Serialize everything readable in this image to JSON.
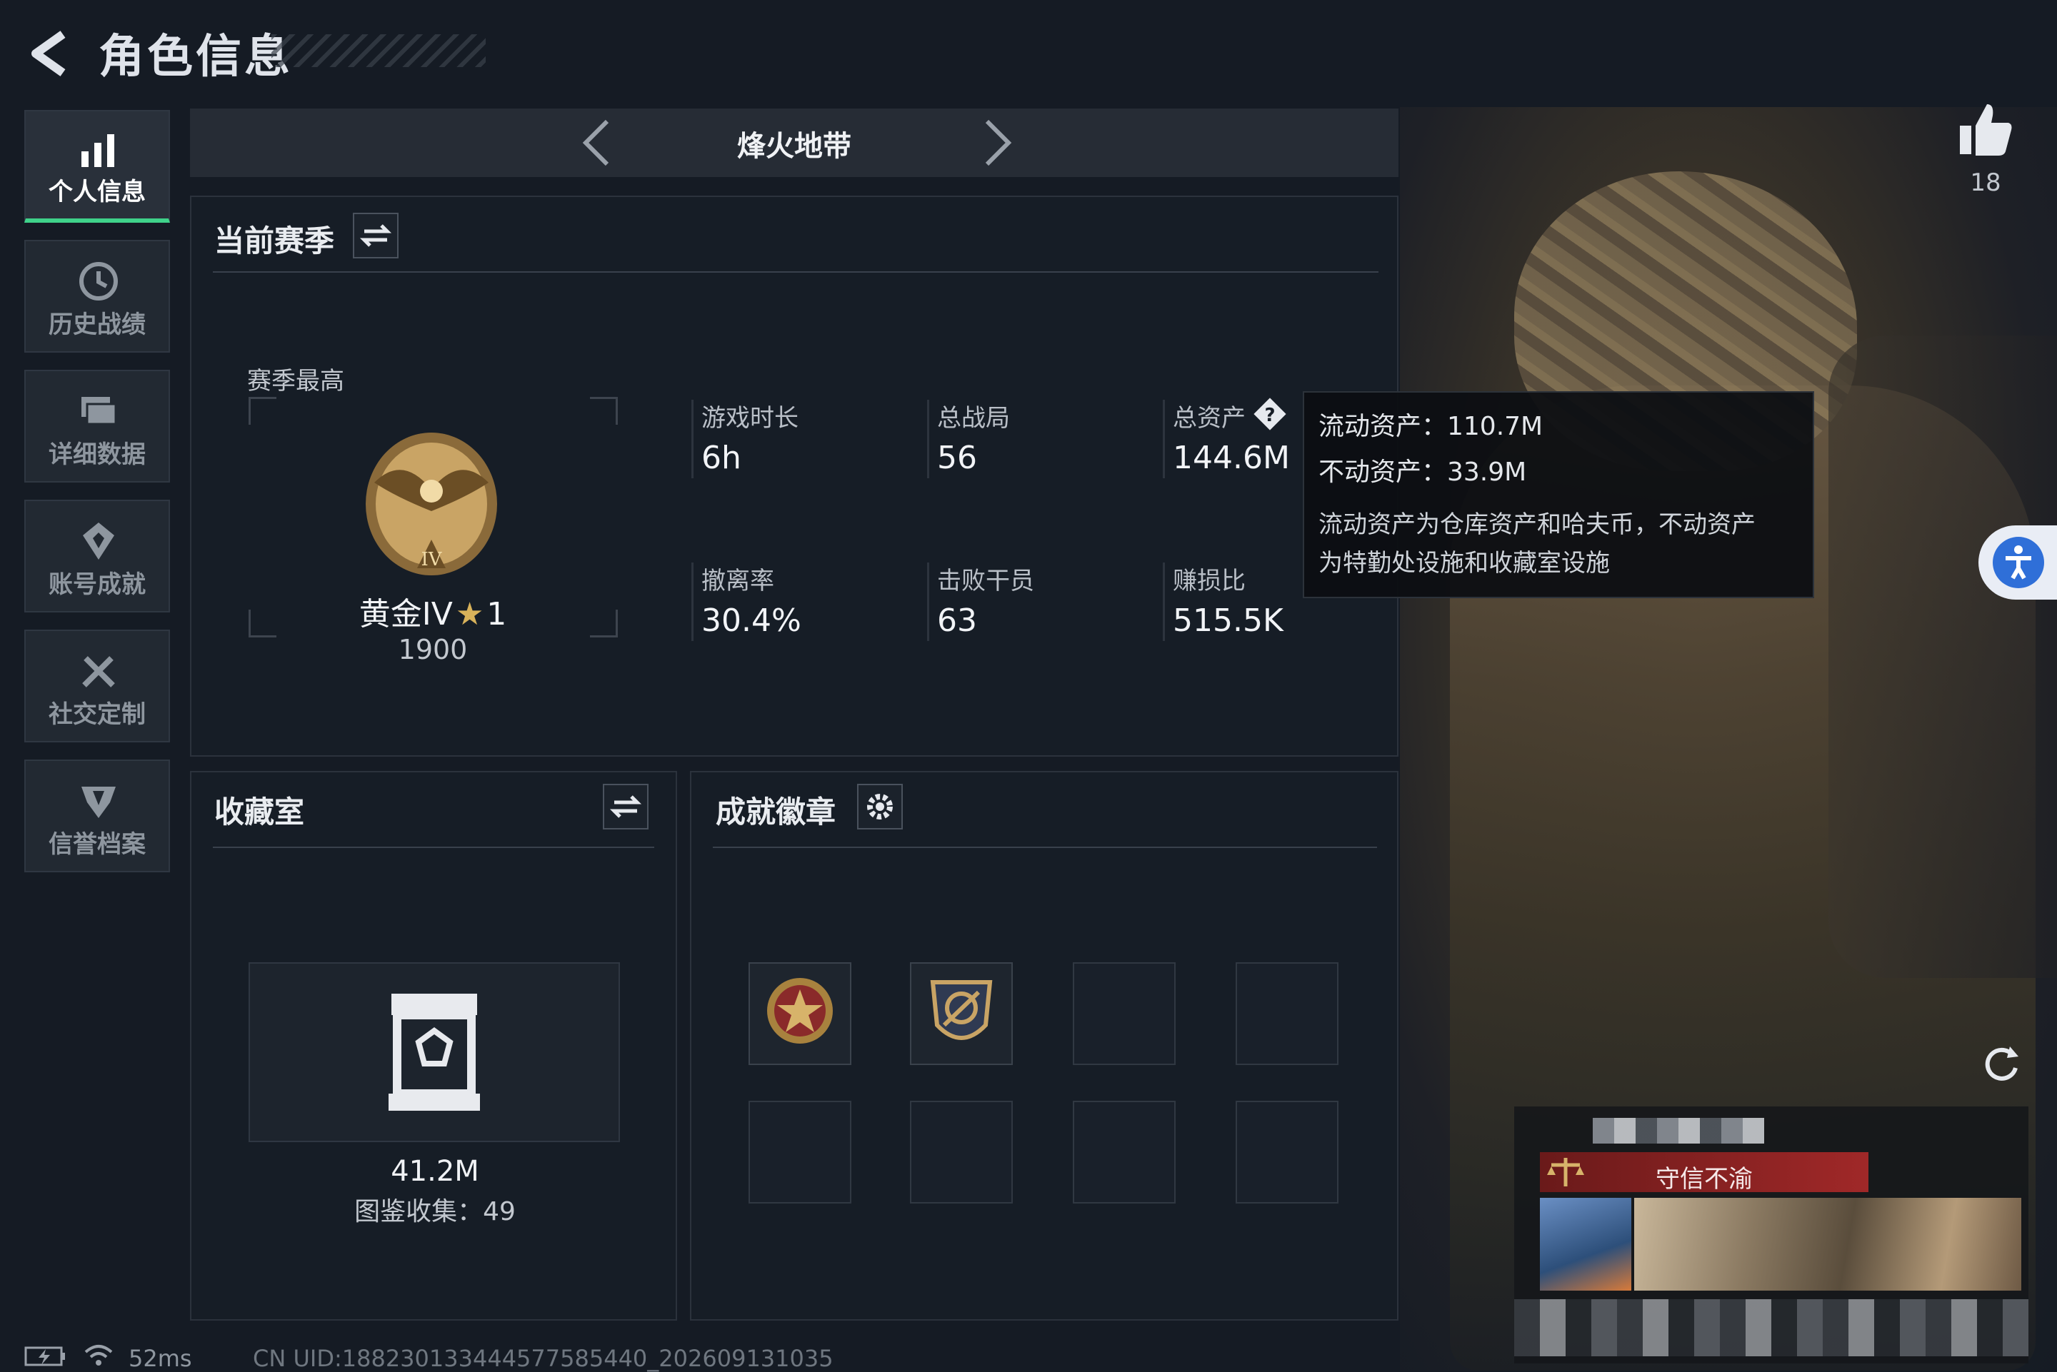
{
  "header": {
    "title": "角色信息"
  },
  "sidebar": {
    "items": [
      {
        "label": "个人信息",
        "icon": "bar-chart-icon",
        "active": true
      },
      {
        "label": "历史战绩",
        "icon": "history-icon"
      },
      {
        "label": "详细数据",
        "icon": "cards-icon"
      },
      {
        "label": "账号成就",
        "icon": "achievement-icon"
      },
      {
        "label": "社交定制",
        "icon": "tools-icon"
      },
      {
        "label": "信誉档案",
        "icon": "shield-icon"
      }
    ]
  },
  "mode": {
    "name": "烽火地带"
  },
  "season": {
    "title": "当前赛季",
    "best_label": "赛季最高",
    "rank_name": "黄金IV",
    "rank_stars": "1",
    "rank_score": "1900",
    "stats": [
      {
        "label": "游戏时长",
        "value": "6h"
      },
      {
        "label": "总战局",
        "value": "56"
      },
      {
        "label": "总资产",
        "value": "144.6M"
      },
      {
        "label": "撤离率",
        "value": "30.4%"
      },
      {
        "label": "击败干员",
        "value": "63"
      },
      {
        "label": "赚损比",
        "value": "515.5K"
      }
    ]
  },
  "tooltip": {
    "liquid": "流动资产：110.7M",
    "fixed": "不动资产：33.9M",
    "desc_line1": "流动资产为仓库资产和哈夫币，不动资产",
    "desc_line2": "为特勤处设施和收藏室设施"
  },
  "collection": {
    "title": "收藏室",
    "value": "41.2M",
    "count_text": "图鉴收集：49"
  },
  "badges": {
    "title": "成就徽章"
  },
  "likes": {
    "count": "18"
  },
  "player_card": {
    "title": "守信不渝"
  },
  "footer": {
    "ping": "52ms",
    "uid": "CN UID:1882301334445775854​40_202609131035"
  },
  "colors": {
    "accent": "#3fd28a",
    "bg": "#151b24",
    "panel": "#161d26",
    "tooltip_bg": "#0c0e12",
    "card_red": "#8a2020",
    "access_blue": "#2f6fd8"
  }
}
